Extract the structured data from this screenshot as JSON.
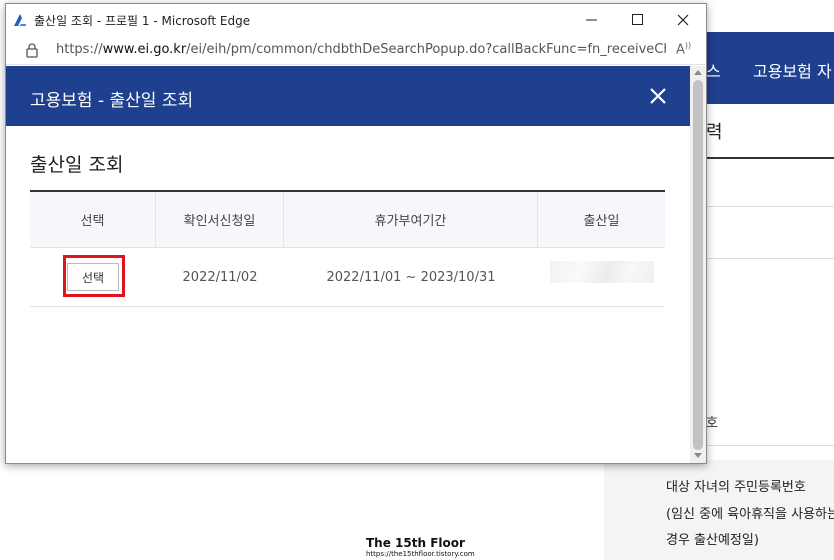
{
  "background": {
    "nav_items": [
      "스",
      "고용보험 자"
    ],
    "section_heading": "력",
    "table_header": "호",
    "texts": [
      "대상 자녀의 주민등록번호",
      "(임신 중에 육아휴직을 사용하는",
      "경우 출산예정일)"
    ]
  },
  "watermark": {
    "title": "The 15th Floor",
    "url": "https://the15thfloor.tistory.com"
  },
  "window": {
    "title": "출산일 조회 - 프로필 1 - Microsoft Edge",
    "url_prefix": "https://",
    "url_domain": "www.ei.go.kr",
    "url_path": "/ei/eih/pm/common/chdbthDeSearchPopup.do?callBackFunc=fn_receiveChd..."
  },
  "popup": {
    "header_title": "고용보험 - 출산일 조회",
    "section_title": "출산일 조회",
    "table": {
      "headers": [
        "선택",
        "확인서신청일",
        "휴가부여기간",
        "출산일"
      ],
      "rows": [
        {
          "select_label": "선택",
          "request_date": "2022/11/02",
          "leave_period": "2022/11/01 ~ 2023/10/31",
          "birth_date": ""
        }
      ]
    }
  },
  "colors": {
    "header_bg": "#1f3f8f",
    "highlight": "#e0141e"
  }
}
